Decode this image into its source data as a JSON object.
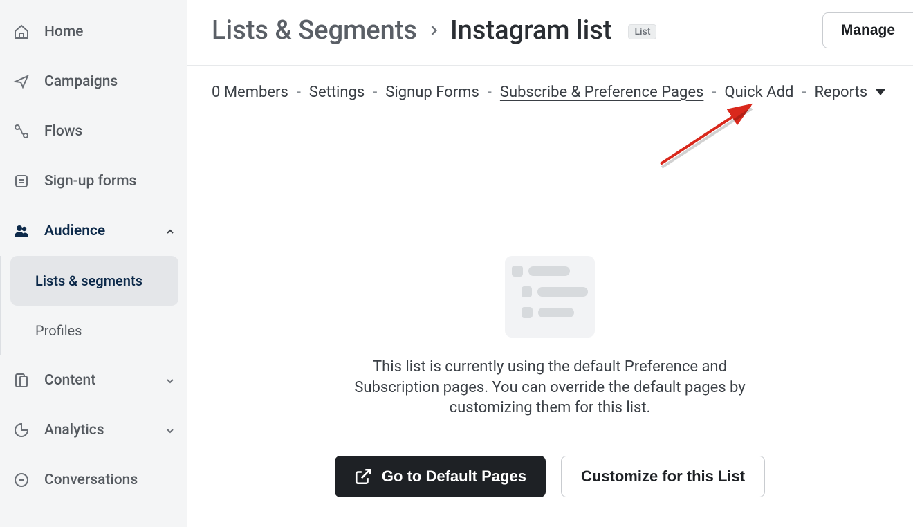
{
  "sidebar": {
    "items": [
      {
        "label": "Home",
        "icon": "home"
      },
      {
        "label": "Campaigns",
        "icon": "paper-plane"
      },
      {
        "label": "Flows",
        "icon": "flow"
      },
      {
        "label": "Sign-up forms",
        "icon": "form"
      },
      {
        "label": "Audience",
        "icon": "people",
        "expanded": true,
        "children": [
          {
            "label": "Lists & segments",
            "active": true
          },
          {
            "label": "Profiles"
          }
        ]
      },
      {
        "label": "Content",
        "icon": "content",
        "expandable": true
      },
      {
        "label": "Analytics",
        "icon": "pie",
        "expandable": true
      },
      {
        "label": "Conversations",
        "icon": "chat"
      }
    ]
  },
  "header": {
    "breadcrumb_root": "Lists & Segments",
    "breadcrumb_leaf": "Instagram list",
    "badge": "List",
    "manage_label": "Manage"
  },
  "tabs": {
    "items": [
      "0 Members",
      "Settings",
      "Signup Forms",
      "Subscribe & Preference Pages",
      "Quick Add",
      "Reports"
    ],
    "active_index": 3,
    "dropdown_index": 5
  },
  "empty_state": {
    "text": "This list is currently using the default Preference and Subscription pages. You can override the default pages by customizing them for this list.",
    "primary_button": "Go to Default Pages",
    "secondary_button": "Customize for this List"
  },
  "annotation_arrow": {
    "color": "#d9281c"
  }
}
